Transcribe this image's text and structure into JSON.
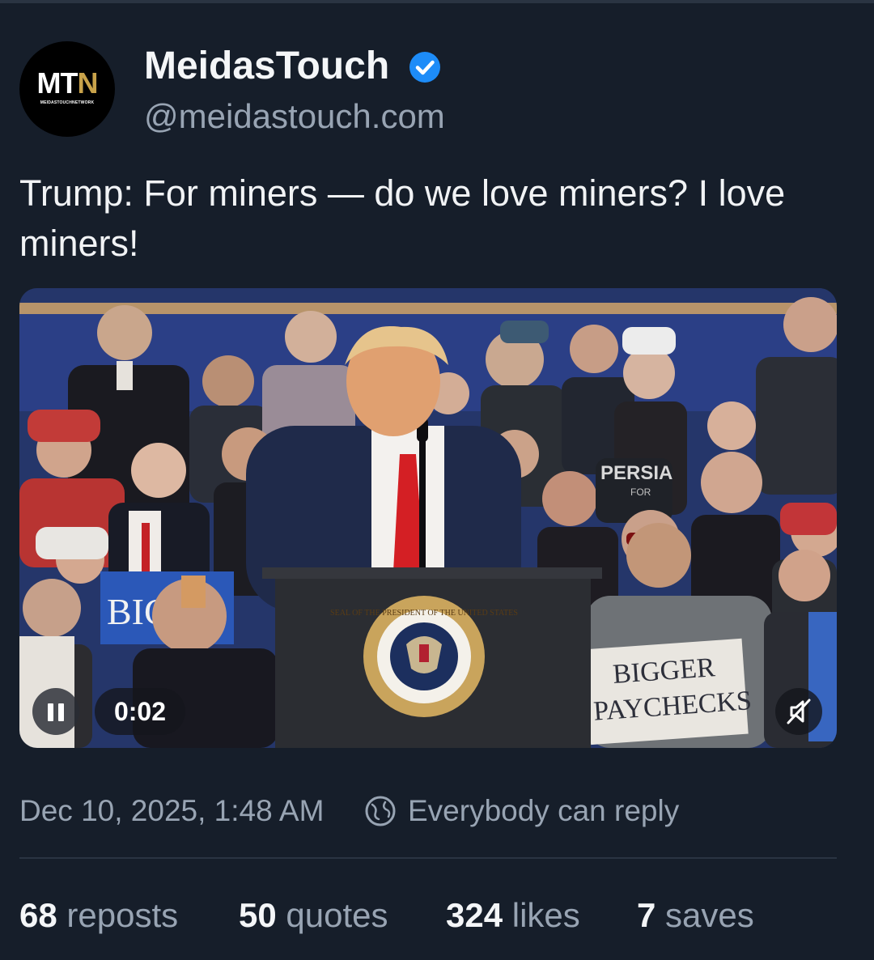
{
  "author": {
    "avatar_logo_main": "MT",
    "avatar_logo_accent": "N",
    "avatar_logo_sub": "MEIDASTOUCHNETWORK",
    "display_name": "MeidasTouch",
    "handle": "@meidastouch.com",
    "verified": true,
    "verified_icon": "verified-check-icon"
  },
  "post": {
    "text": "Trump: For miners — do we love miners? I love miners!",
    "video": {
      "elapsed": "0:02",
      "state": "playing",
      "muted": true,
      "signs": {
        "left_sign": "BIGG",
        "right_sign_line1": "BIGGER",
        "right_sign_line2": "PAYCHECKS",
        "shirt_text": "PERSIA",
        "shirt_sub": "FOR",
        "seal_text": "SEAL OF THE PRESIDENT OF THE UNITED STATES"
      }
    },
    "timestamp": "Dec 10, 2025, 1:48 AM",
    "reply_setting": "Everybody can reply",
    "reply_icon": "globe-icon"
  },
  "stats": {
    "reposts": {
      "count": "68",
      "label": "reposts"
    },
    "quotes": {
      "count": "50",
      "label": "quotes"
    },
    "likes": {
      "count": "324",
      "label": "likes"
    },
    "saves": {
      "count": "7",
      "label": "saves"
    }
  },
  "colors": {
    "background": "#161e2a",
    "primary_text": "#f1f3f5",
    "secondary_text": "#98a4b3",
    "verified_blue": "#1d8cf8",
    "divider": "#2a3442"
  }
}
